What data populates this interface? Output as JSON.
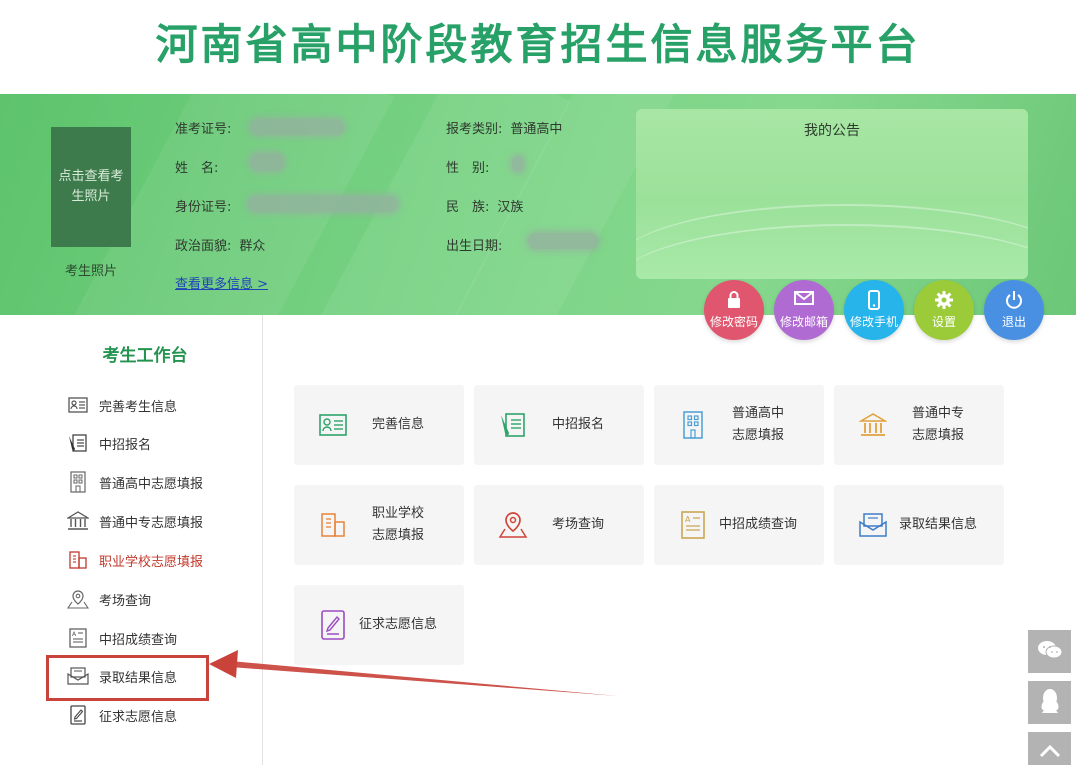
{
  "header": {
    "title": "河南省高中阶段教育招生信息服务平台"
  },
  "profile": {
    "photo_button": "点击查看考生照片",
    "photo_label": "考生照片",
    "fields": {
      "exam_no": {
        "label": "准考证号:",
        "value": ""
      },
      "name": {
        "label": "姓　名:",
        "value": ""
      },
      "id_no": {
        "label": "身份证号:",
        "value": ""
      },
      "politics": {
        "label": "政治面貌:",
        "value": "群众"
      },
      "exam_type": {
        "label": "报考类别:",
        "value": "普通高中"
      },
      "gender": {
        "label": "性　别:",
        "value": ""
      },
      "ethnicity": {
        "label": "民　族:",
        "value": "汉族"
      },
      "birth": {
        "label": "出生日期:",
        "value": ""
      }
    },
    "more_link": "查看更多信息 >"
  },
  "notice": {
    "title": "我的公告"
  },
  "actions": [
    {
      "label": "修改密码",
      "icon": "lock-icon",
      "color": "#e0566f"
    },
    {
      "label": "修改邮箱",
      "icon": "mail-icon",
      "color": "#b06bd3"
    },
    {
      "label": "修改手机",
      "icon": "phone-icon",
      "color": "#27b4ea"
    },
    {
      "label": "设置",
      "icon": "gear-icon",
      "color": "#9ccb3a"
    },
    {
      "label": "退出",
      "icon": "power-icon",
      "color": "#4a90e2"
    }
  ],
  "sidebar": {
    "title": "考生工作台",
    "items": [
      {
        "label": "完善考生信息",
        "icon": "id-card-icon"
      },
      {
        "label": "中招报名",
        "icon": "form-edit-icon"
      },
      {
        "label": "普通高中志愿填报",
        "icon": "building-icon"
      },
      {
        "label": "普通中专志愿填报",
        "icon": "institution-icon"
      },
      {
        "label": "职业学校志愿填报",
        "icon": "school-building-icon",
        "active": true
      },
      {
        "label": "考场查询",
        "icon": "location-pin-icon"
      },
      {
        "label": "中招成绩查询",
        "icon": "score-sheet-icon"
      },
      {
        "label": "录取结果信息",
        "icon": "envelope-icon",
        "highlighted": true
      },
      {
        "label": "征求志愿信息",
        "icon": "note-edit-icon"
      }
    ]
  },
  "tiles": [
    {
      "label": "完善信息",
      "icon": "id-card-icon",
      "color": "#2ea36a"
    },
    {
      "label": "中招报名",
      "icon": "form-edit-icon",
      "color": "#2ea36a"
    },
    {
      "label": "普通高中\n志愿填报",
      "icon": "building-icon",
      "color": "#4b9fd6"
    },
    {
      "label": "普通中专\n志愿填报",
      "icon": "institution-icon",
      "color": "#e2a03b"
    },
    {
      "label": "职业学校\n志愿填报",
      "icon": "school-building-icon",
      "color": "#e8833a"
    },
    {
      "label": "考场查询",
      "icon": "location-pin-icon",
      "color": "#d0453a"
    },
    {
      "label": "中招成绩查询",
      "icon": "score-sheet-icon",
      "color": "#c9a24a"
    },
    {
      "label": "录取结果信息",
      "icon": "envelope-icon",
      "color": "#3f7cc8"
    },
    {
      "label": "征求志愿信息",
      "icon": "note-edit-icon",
      "color": "#9b4dc2"
    }
  ],
  "float_bar": [
    {
      "icon": "wechat-icon"
    },
    {
      "icon": "qq-icon"
    },
    {
      "icon": "back-to-top-icon"
    }
  ]
}
